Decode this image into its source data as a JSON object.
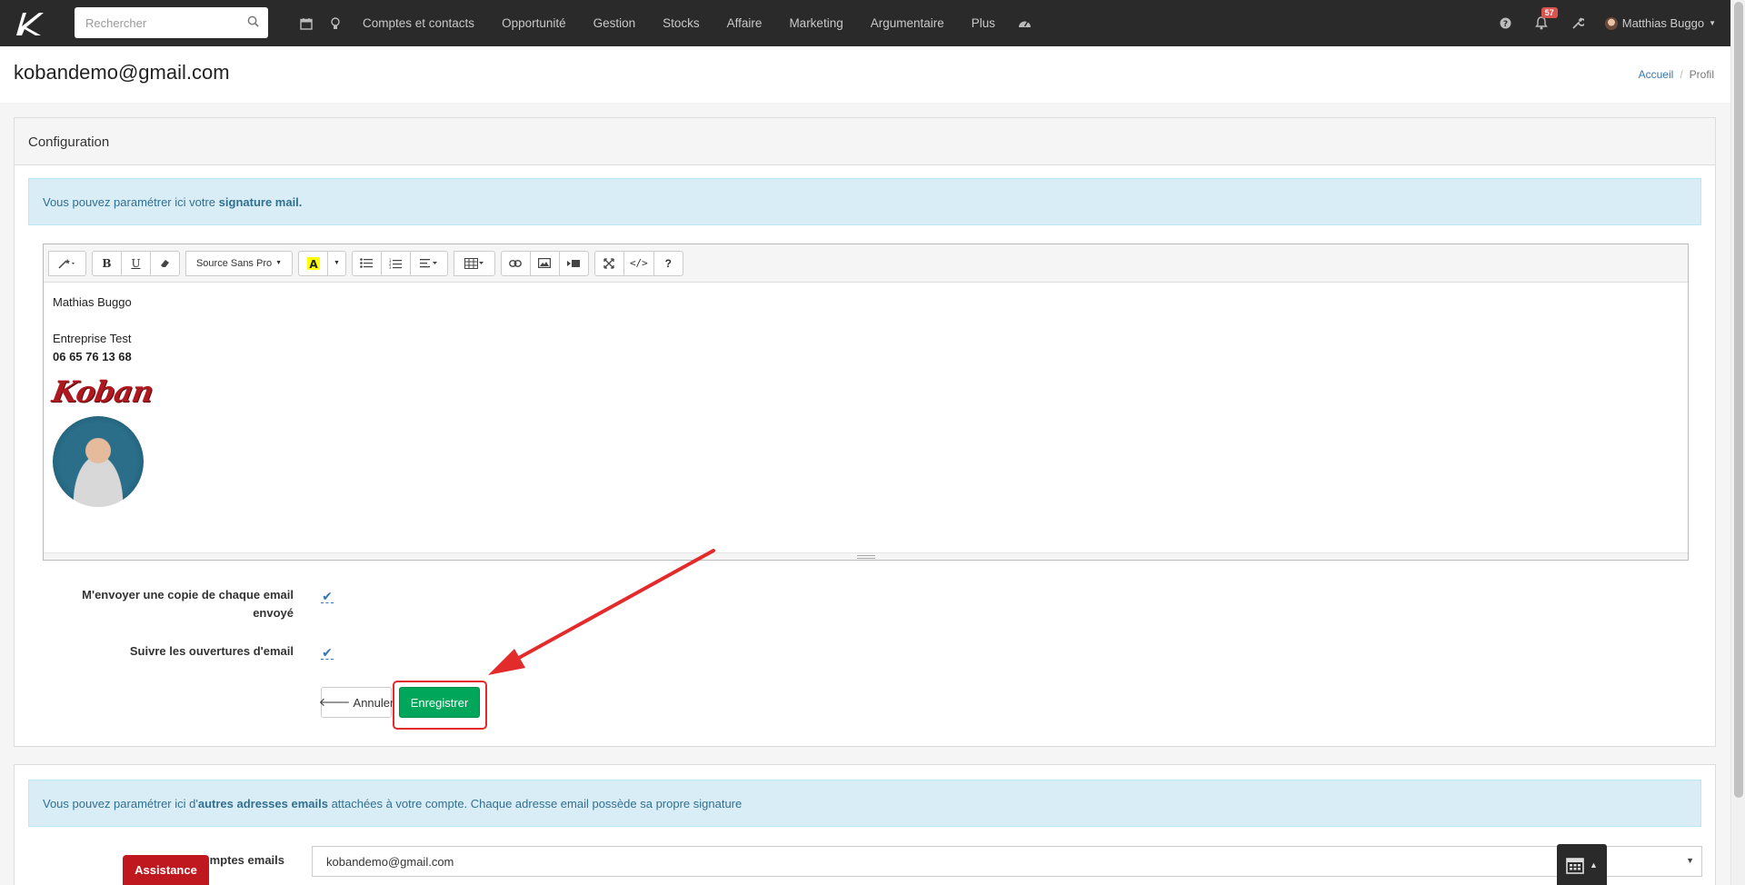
{
  "nav": {
    "search_placeholder": "Rechercher",
    "items": [
      "Comptes et contacts",
      "Opportunité",
      "Gestion",
      "Stocks",
      "Affaire",
      "Marketing",
      "Argumentaire",
      "Plus"
    ],
    "notification_count": "57",
    "user_name": "Matthias Buggo"
  },
  "header": {
    "title": "kobandemo@gmail.com",
    "breadcrumb_home": "Accueil",
    "breadcrumb_sep": "/",
    "breadcrumb_current": "Profil"
  },
  "config": {
    "heading": "Configuration",
    "info_prefix": "Vous pouvez paramétrer ici votre ",
    "info_bold": "signature mail."
  },
  "editor": {
    "font_name": "Source Sans Pro",
    "lines": {
      "name": "Mathias Buggo",
      "company": "Entreprise Test",
      "phone": "06 65 76 13 68"
    },
    "logo_text": "Koban"
  },
  "options": {
    "copy_label_1": "M'envoyer une copie de chaque email",
    "copy_label_2": "envoyé",
    "copy_checked": true,
    "track_label": "Suivre les ouvertures d'email",
    "track_checked": true
  },
  "buttons": {
    "cancel": "Annuler",
    "save": "Enregistrer"
  },
  "other": {
    "info_prefix": "Vous pouvez paramétrer ici d'",
    "info_bold": "autres adresses emails",
    "info_suffix": " attachées à votre compte. Chaque adresse email possède sa propre signature",
    "accounts_label": "mptes emails",
    "selected_email": "kobandemo@gmail.com"
  },
  "assistance_label": "Assistance",
  "colors": {
    "nav_bg": "#2a2a2a",
    "accent_blue": "#3277b3",
    "save_green": "#00a65a",
    "highlight_red": "#e32b2b",
    "assist_red": "#c0181f"
  }
}
